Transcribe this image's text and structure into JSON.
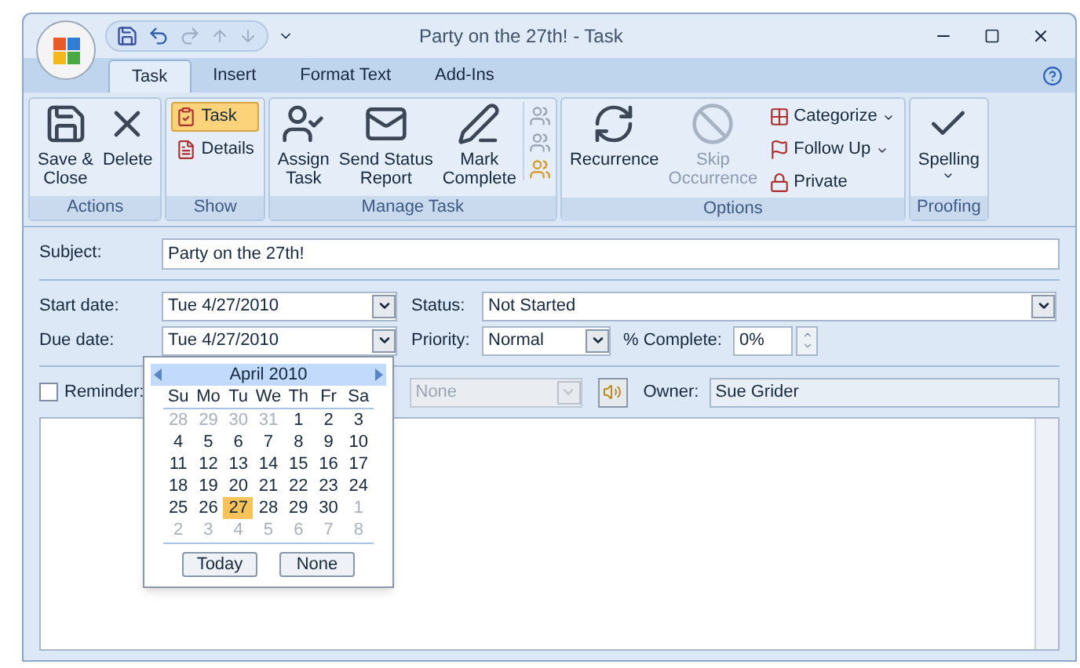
{
  "window": {
    "title": "Party on the 27th! - Task"
  },
  "tabs": [
    {
      "label": "Task",
      "selected": true
    },
    {
      "label": "Insert",
      "selected": false
    },
    {
      "label": "Format Text",
      "selected": false
    },
    {
      "label": "Add-Ins",
      "selected": false
    }
  ],
  "ribbon": [
    {
      "label": "Actions",
      "buttons": [
        {
          "kind": "large",
          "label": "Save &\nClose",
          "disabled": false
        },
        {
          "kind": "large",
          "label": "Delete",
          "disabled": false
        }
      ]
    },
    {
      "label": "Show",
      "buttons": [
        {
          "kind": "small",
          "label": "Task",
          "selected": true
        },
        {
          "kind": "small",
          "label": "Details",
          "selected": false
        }
      ]
    },
    {
      "label": "Manage Task",
      "buttons": [
        {
          "kind": "large",
          "label": "Assign\nTask",
          "disabled": false
        },
        {
          "kind": "large",
          "label": "Send Status\nReport",
          "disabled": false
        },
        {
          "kind": "large",
          "label": "Mark\nComplete",
          "disabled": false
        },
        {
          "kind": "iconstack"
        }
      ]
    },
    {
      "label": "Options",
      "buttons": [
        {
          "kind": "large",
          "label": "Recurrence",
          "disabled": false
        },
        {
          "kind": "large",
          "label": "Skip\nOccurrence",
          "disabled": true
        },
        {
          "kind": "small",
          "label": "Categorize",
          "dropdown": true,
          "selected": false
        },
        {
          "kind": "small",
          "label": "Follow Up",
          "dropdown": true,
          "selected": false
        },
        {
          "kind": "small",
          "label": "Private",
          "dropdown": false,
          "selected": false
        }
      ]
    },
    {
      "label": "Proofing",
      "buttons": [
        {
          "kind": "large",
          "label": "Spelling",
          "disabled": false,
          "dropdown": true
        }
      ]
    }
  ],
  "form": {
    "subject": {
      "label": "Subject:",
      "value": "Party on the 27th!"
    },
    "start_date": {
      "label": "Start date:",
      "value": "Tue 4/27/2010"
    },
    "due_date": {
      "label": "Due date:",
      "value": "Tue 4/27/2010"
    },
    "status": {
      "label": "Status:",
      "value": "Not Started"
    },
    "priority": {
      "label": "Priority:",
      "value": "Normal"
    },
    "percent_complete": {
      "label": "% Complete:",
      "value": "0%"
    },
    "reminder": {
      "label": "Reminder:",
      "checked": false
    },
    "reminder_time": {
      "value": "None",
      "disabled": true
    },
    "owner": {
      "label": "Owner:",
      "value": "Sue Grider"
    }
  },
  "calendar": {
    "month": "April 2010",
    "weekdays": [
      "Su",
      "Mo",
      "Tu",
      "We",
      "Th",
      "Fr",
      "Sa"
    ],
    "weeks": [
      [
        {
          "day": "28",
          "muted": true,
          "selected": false
        },
        {
          "day": "29",
          "muted": true,
          "selected": false
        },
        {
          "day": "30",
          "muted": true,
          "selected": false
        },
        {
          "day": "31",
          "muted": true,
          "selected": false
        },
        {
          "day": "1",
          "muted": false,
          "selected": false
        },
        {
          "day": "2",
          "muted": false,
          "selected": false
        },
        {
          "day": "3",
          "muted": false,
          "selected": false
        }
      ],
      [
        {
          "day": "4",
          "muted": false,
          "selected": false
        },
        {
          "day": "5",
          "muted": false,
          "selected": false
        },
        {
          "day": "6",
          "muted": false,
          "selected": false
        },
        {
          "day": "7",
          "muted": false,
          "selected": false
        },
        {
          "day": "8",
          "muted": false,
          "selected": false
        },
        {
          "day": "9",
          "muted": false,
          "selected": false
        },
        {
          "day": "10",
          "muted": false,
          "selected": false
        }
      ],
      [
        {
          "day": "11",
          "muted": false,
          "selected": false
        },
        {
          "day": "12",
          "muted": false,
          "selected": false
        },
        {
          "day": "13",
          "muted": false,
          "selected": false
        },
        {
          "day": "14",
          "muted": false,
          "selected": false
        },
        {
          "day": "15",
          "muted": false,
          "selected": false
        },
        {
          "day": "16",
          "muted": false,
          "selected": false
        },
        {
          "day": "17",
          "muted": false,
          "selected": false
        }
      ],
      [
        {
          "day": "18",
          "muted": false,
          "selected": false
        },
        {
          "day": "19",
          "muted": false,
          "selected": false
        },
        {
          "day": "20",
          "muted": false,
          "selected": false
        },
        {
          "day": "21",
          "muted": false,
          "selected": false
        },
        {
          "day": "22",
          "muted": false,
          "selected": false
        },
        {
          "day": "23",
          "muted": false,
          "selected": false
        },
        {
          "day": "24",
          "muted": false,
          "selected": false
        }
      ],
      [
        {
          "day": "25",
          "muted": false,
          "selected": false
        },
        {
          "day": "26",
          "muted": false,
          "selected": false
        },
        {
          "day": "27",
          "muted": false,
          "selected": true
        },
        {
          "day": "28",
          "muted": false,
          "selected": false
        },
        {
          "day": "29",
          "muted": false,
          "selected": false
        },
        {
          "day": "30",
          "muted": false,
          "selected": false
        },
        {
          "day": "1",
          "muted": true,
          "selected": false
        }
      ],
      [
        {
          "day": "2",
          "muted": true,
          "selected": false
        },
        {
          "day": "3",
          "muted": true,
          "selected": false
        },
        {
          "day": "4",
          "muted": true,
          "selected": false
        },
        {
          "day": "5",
          "muted": true,
          "selected": false
        },
        {
          "day": "6",
          "muted": true,
          "selected": false
        },
        {
          "day": "7",
          "muted": true,
          "selected": false
        },
        {
          "day": "8",
          "muted": true,
          "selected": false
        }
      ]
    ],
    "buttons": [
      "Today",
      "None"
    ]
  }
}
